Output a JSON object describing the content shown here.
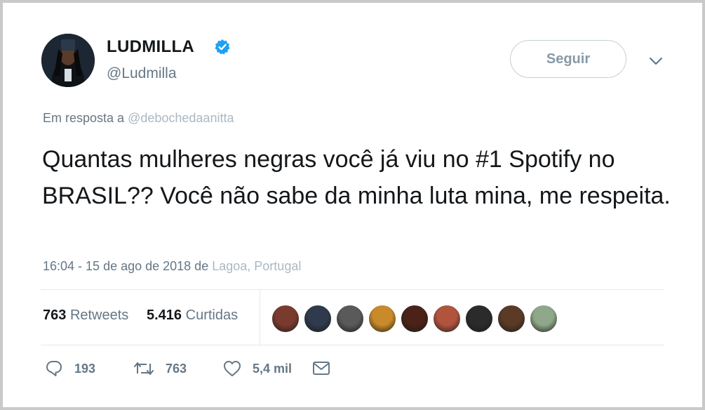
{
  "author": {
    "display_name": "LUDMILLA",
    "handle": "@Ludmilla",
    "verified_icon": "verified-badge-icon",
    "accent_color": "#1da1f2"
  },
  "follow_button": {
    "label": "Seguir"
  },
  "menu": {
    "icon": "chevron-down-icon"
  },
  "reply_to": {
    "prefix": "Em resposta a",
    "mention": "@debochedaanitta"
  },
  "tweet": {
    "text": "Quantas mulheres negras você já viu no #1 Spotify no BRASIL?? Você não sabe da minha luta mina, me respeita."
  },
  "meta": {
    "time_date": "16:04 - 15 de ago de 2018 de",
    "location": "Lagoa, Portugal"
  },
  "stats": {
    "retweets_count": "763",
    "retweets_label": "Retweets",
    "likes_count": "5.416",
    "likes_label": "Curtidas"
  },
  "likers": {
    "count_shown": 9,
    "colors": [
      "#7a3b2e",
      "#2f3a4c",
      "#5a5a5a",
      "#c98a2a",
      "#4a2218",
      "#b0543e",
      "#2b2b2b",
      "#5b3a26",
      "#8fa88a"
    ]
  },
  "actions": {
    "reply_count": "193",
    "retweet_count": "763",
    "like_count": "5,4 mil"
  }
}
